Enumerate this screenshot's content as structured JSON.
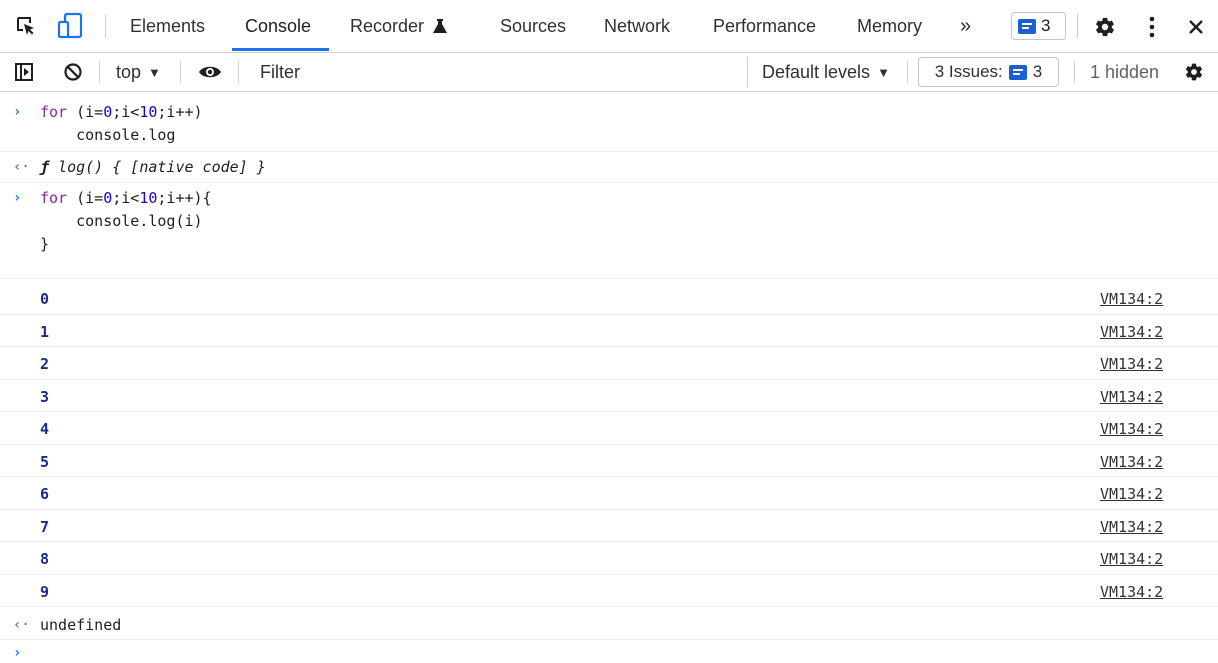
{
  "tabs": {
    "elements": "Elements",
    "console": "Console",
    "recorder": "Recorder",
    "sources": "Sources",
    "network": "Network",
    "performance": "Performance",
    "memory": "Memory",
    "more": "»",
    "messages_count": "3"
  },
  "toolbar": {
    "context": "top",
    "filter_placeholder": "Filter",
    "levels": "Default levels",
    "issues_label": "3 Issues:",
    "issues_count": "3",
    "hidden": "1 hidden"
  },
  "console": {
    "entry1": {
      "kw": "for",
      "pre": " (i=",
      "n0": "0",
      "mid": ";i<",
      "n10": "10",
      "post": ";i++)",
      "line2": "    console.log"
    },
    "output1": {
      "f": "ƒ",
      "text": " log() { [native code] }"
    },
    "entry2": {
      "kw": "for",
      "pre": " (i=",
      "n0": "0",
      "mid": ";i<",
      "n10": "10",
      "post": ";i++){",
      "line2": "    console.log(i)",
      "line3": "}"
    },
    "logs": [
      {
        "value": "0",
        "source": "VM134:2"
      },
      {
        "value": "1",
        "source": "VM134:2"
      },
      {
        "value": "2",
        "source": "VM134:2"
      },
      {
        "value": "3",
        "source": "VM134:2"
      },
      {
        "value": "4",
        "source": "VM134:2"
      },
      {
        "value": "5",
        "source": "VM134:2"
      },
      {
        "value": "6",
        "source": "VM134:2"
      },
      {
        "value": "7",
        "source": "VM134:2"
      },
      {
        "value": "8",
        "source": "VM134:2"
      },
      {
        "value": "9",
        "source": "VM134:2"
      }
    ],
    "result": "undefined"
  },
  "colors": {
    "accent": "#1a73e8",
    "keyword": "#8a2c9a",
    "number": "#1c00cf",
    "log_value": "#1c2a8c"
  }
}
